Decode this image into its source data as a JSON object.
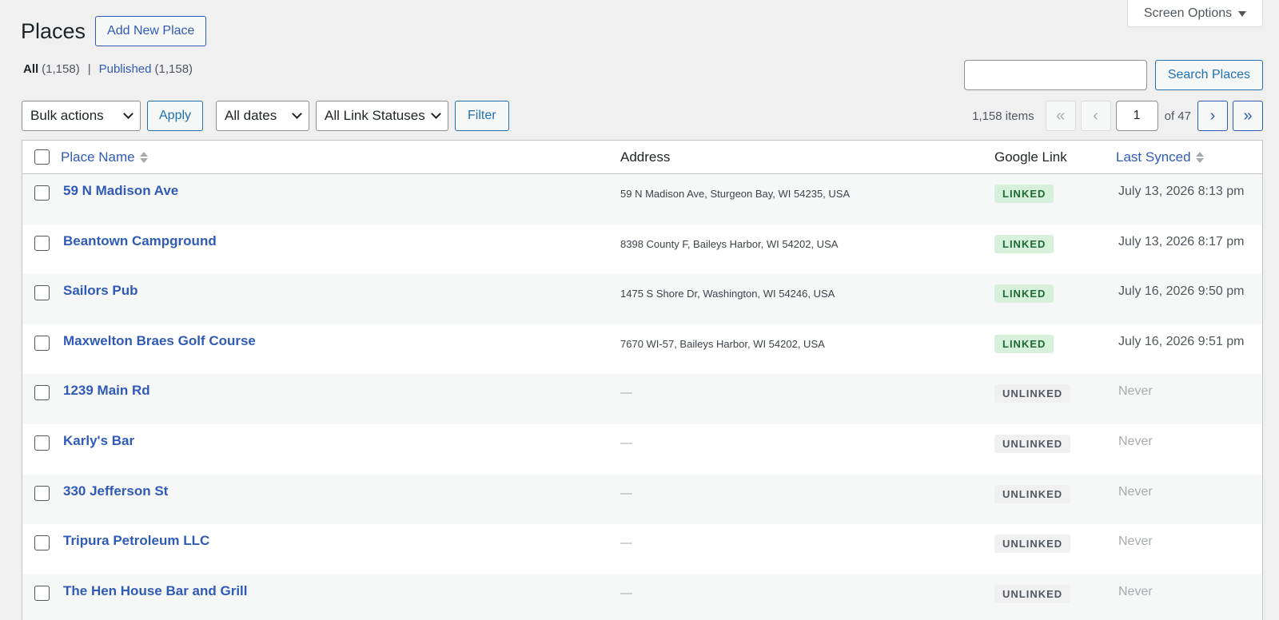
{
  "header": {
    "title": "Places",
    "add_new_label": "Add New Place",
    "screen_options_label": "Screen Options"
  },
  "views": {
    "all_label": "All",
    "all_count": "(1,158)",
    "separator": "|",
    "published_label": "Published",
    "published_count": "(1,158)"
  },
  "search": {
    "value": "",
    "button_label": "Search Places"
  },
  "tablenav": {
    "bulk_actions": "Bulk actions",
    "apply_label": "Apply",
    "dates": "All dates",
    "link_statuses": "All Link Statuses",
    "filter_label": "Filter",
    "items_count": "1,158 items",
    "first_page": "«",
    "prev_page": "‹",
    "current_page": "1",
    "of_total": "of 47",
    "next_page": "›",
    "last_page": "»"
  },
  "table": {
    "columns": {
      "name": "Place Name",
      "address": "Address",
      "google_link": "Google Link",
      "last_synced": "Last Synced"
    },
    "rows": [
      {
        "name": "59 N Madison Ave",
        "address": "59 N Madison Ave, Sturgeon Bay, WI 54235, USA",
        "status": "LINKED",
        "synced": "July 13, 2026 8:13 pm"
      },
      {
        "name": "Beantown Campground",
        "address": "8398 County F, Baileys Harbor, WI 54202, USA",
        "status": "LINKED",
        "synced": "July 13, 2026 8:17 pm"
      },
      {
        "name": "Sailors Pub",
        "address": "1475 S Shore Dr, Washington, WI 54246, USA",
        "status": "LINKED",
        "synced": "July 16, 2026 9:50 pm"
      },
      {
        "name": "Maxwelton Braes Golf Course",
        "address": "7670 WI-57, Baileys Harbor, WI 54202, USA",
        "status": "LINKED",
        "synced": "July 16, 2026 9:51 pm"
      },
      {
        "name": "1239 Main Rd",
        "address": "—",
        "status": "UNLINKED",
        "synced": "Never"
      },
      {
        "name": "Karly's Bar",
        "address": "—",
        "status": "UNLINKED",
        "synced": "Never"
      },
      {
        "name": "330 Jefferson St",
        "address": "—",
        "status": "UNLINKED",
        "synced": "Never"
      },
      {
        "name": "Tripura Petroleum LLC",
        "address": "—",
        "status": "UNLINKED",
        "synced": "Never"
      },
      {
        "name": "The Hen House Bar and Grill",
        "address": "—",
        "status": "UNLINKED",
        "synced": "Never"
      }
    ]
  },
  "colors": {
    "link": "#2f5bb7",
    "linked_bg": "#d7f0dc",
    "linked_text": "#1d6a34",
    "unlinked_bg": "#f0f0f1",
    "page_bg": "#f0f0f1"
  }
}
